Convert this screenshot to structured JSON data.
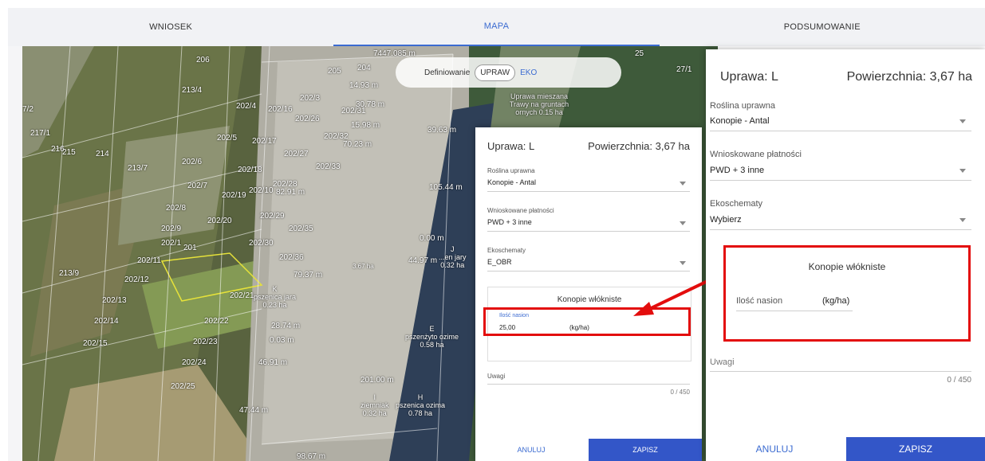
{
  "tabs": [
    "WNIOSEK",
    "MAPA",
    "PODSUMOWANIE"
  ],
  "map": {
    "toggle": {
      "label": "Definiowanie",
      "option_selected": "UPRAW",
      "option_other": "EKO"
    },
    "parcel_labels": [
      "206",
      "205",
      "204",
      "213/4",
      "202/3",
      "202/4",
      "202/16",
      "202/31",
      "202/26",
      "217/1",
      "216",
      "215",
      "214",
      "202/5",
      "202/17",
      "202/32",
      "213/7",
      "202/6",
      "202/18",
      "202/27",
      "202/33",
      "202/7",
      "202/19",
      "202/10",
      "202/28",
      "202/8",
      "202/29",
      "202/20",
      "202/9",
      "202/35",
      "202/1",
      "201",
      "202/30",
      "202/11",
      "202/36",
      "213/9",
      "202/12",
      "202/21",
      "202/13",
      "202/22",
      "202/14",
      "202/23",
      "202/15",
      "202/24",
      "202/25",
      "27/1",
      "25",
      "7/2"
    ],
    "measurements": [
      "7447.085 m",
      "14.93 m",
      "30.78 m",
      "15.98 m",
      "70.23 m",
      "39.63 m",
      "82.91 m",
      "105.44 m",
      "0.00 m",
      "44.97 m",
      "79.37 m",
      "28.74 m",
      "0.03 m",
      "46.91 m",
      "201.00 m",
      "47.44 m",
      "98.67 m"
    ],
    "crop_labels": [
      {
        "letter": "K",
        "name": "pszenica jara",
        "area": "0.23 ha"
      },
      {
        "letter": "E",
        "name": "pszenżyto ozime",
        "area": "0.58 ha"
      },
      {
        "letter": "I",
        "name": "ziemniak",
        "area": "0.32 ha"
      },
      {
        "letter": "H",
        "name": "pszenica ozima",
        "area": "0.78 ha"
      },
      {
        "letter": "J",
        "name": "...en jary",
        "area": "0.32 ha"
      }
    ],
    "area_label": "3.67 ha",
    "misc_label": "Uprawa mieszana Trawy na gruntach ornych 0.15 ha"
  },
  "dialog_small": {
    "title": "Uprawa: L",
    "area": "Powierzchnia: 3,67 ha",
    "crop_label": "Roślina uprawna",
    "crop_value": "Konopie - Antal",
    "payments_label": "Wnioskowane płatności",
    "payments_value": "PWD + 3 inne",
    "eco_label": "Ekoschematy",
    "eco_value": "E_OBR",
    "section_title": "Konopie włókniste",
    "seeds_label": "Ilość nasion",
    "seeds_value": "25,00",
    "seeds_unit": "(kg/ha)",
    "notes_label": "Uwagi",
    "notes_counter": "0 / 450",
    "cancel": "ANULUJ",
    "save": "ZAPISZ"
  },
  "dialog_large": {
    "title": "Uprawa: L",
    "area": "Powierzchnia: 3,67 ha",
    "crop_label": "Roślina uprawna",
    "crop_value": "Konopie - Antal",
    "payments_label": "Wnioskowane płatności",
    "payments_value": "PWD + 3 inne",
    "eco_label": "Ekoschematy",
    "eco_value": "Wybierz",
    "section_title": "Konopie włókniste",
    "seeds_label": "Ilość nasion",
    "seeds_unit": "(kg/ha)",
    "notes_label": "Uwagi",
    "notes_counter": "0 / 450",
    "cancel": "ANULUJ",
    "save": "ZAPISZ"
  },
  "colors": {
    "accent": "#3b6bd1",
    "save_button": "#3356c8",
    "highlight": "#e30d0d"
  }
}
